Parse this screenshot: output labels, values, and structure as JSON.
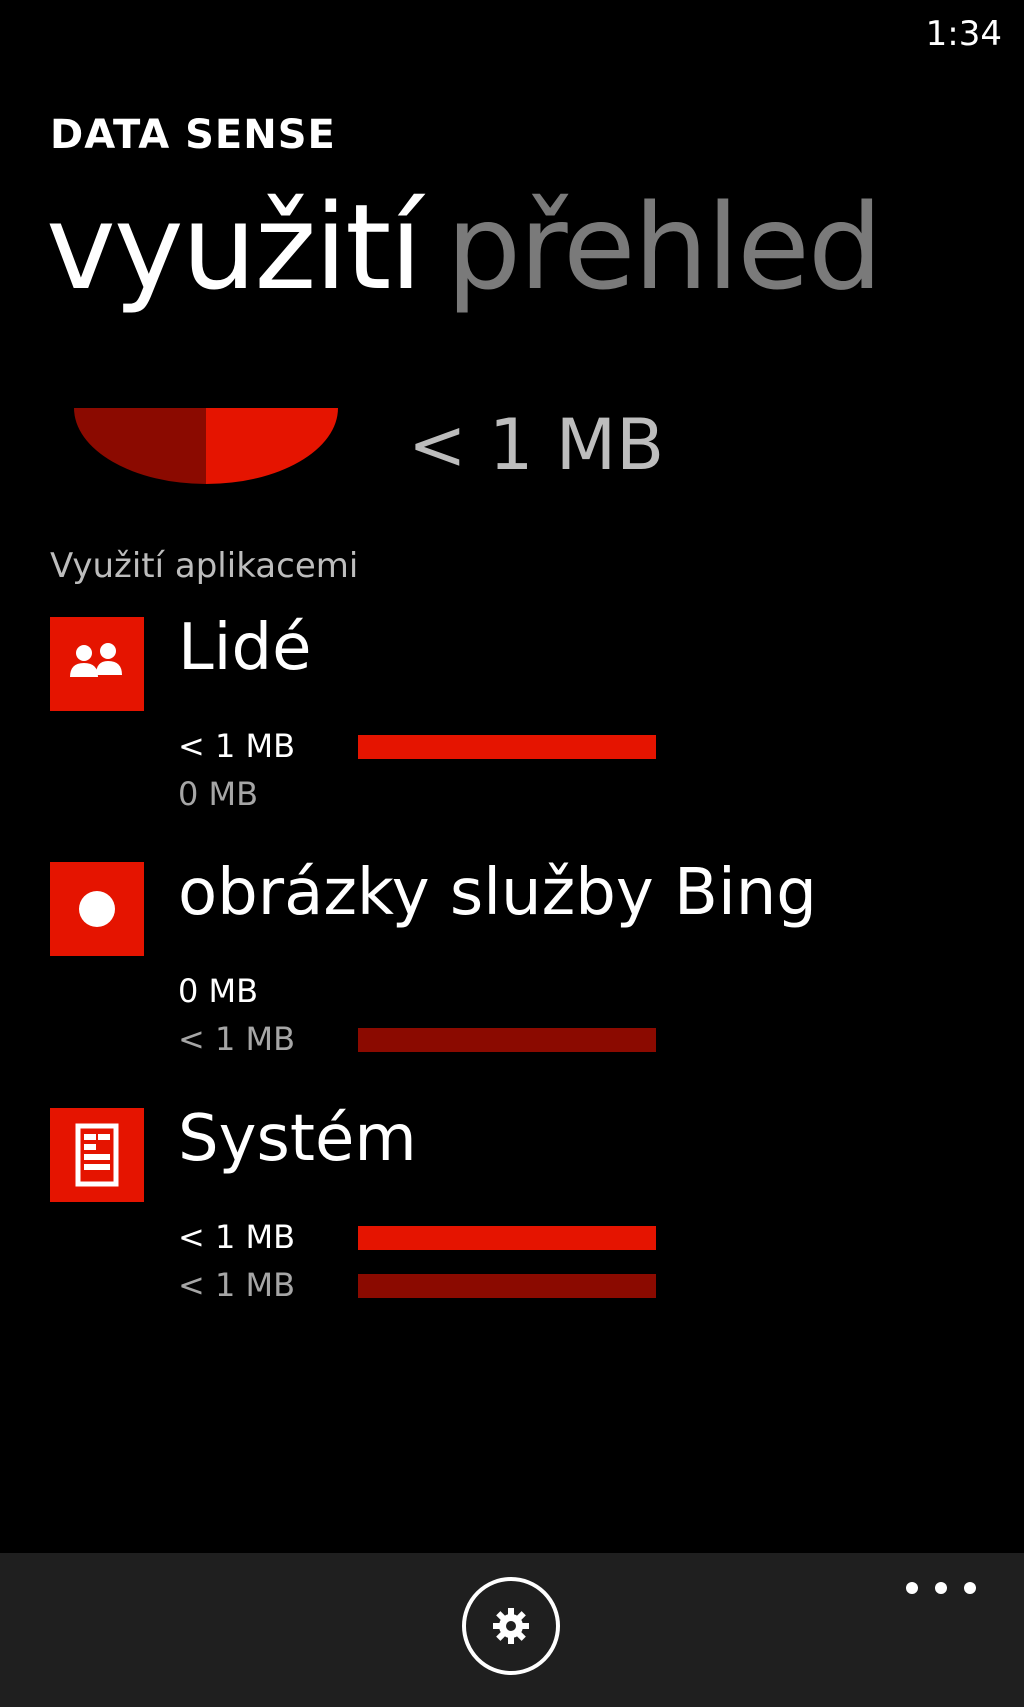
{
  "status_bar": {
    "time": "1:34"
  },
  "header": {
    "app_title": "DATA SENSE",
    "pivot_tabs": [
      {
        "label": "využití",
        "active": true
      },
      {
        "label": "přehled",
        "active": false
      }
    ]
  },
  "summary": {
    "total_usage": "< 1 MB",
    "gauge_fill_fraction": 1.0
  },
  "section_label": "Využití aplikacemi",
  "apps": [
    {
      "name": "Lidé",
      "icon": "people-icon",
      "mobile_usage": "< 1 MB",
      "wifi_usage": "0 MB",
      "mobile_bar_fraction": 1.0,
      "wifi_bar_fraction": 0
    },
    {
      "name": "obrázky služby Bing",
      "icon": "bing-images-icon",
      "mobile_usage": "0 MB",
      "wifi_usage": "< 1 MB",
      "mobile_bar_fraction": 0,
      "wifi_bar_fraction": 1.0
    },
    {
      "name": "Systém",
      "icon": "system-icon",
      "mobile_usage": "< 1 MB",
      "wifi_usage": "< 1 MB",
      "mobile_bar_fraction": 1.0,
      "wifi_bar_fraction": 1.0
    }
  ],
  "app_bar": {
    "settings_icon": "gear-icon",
    "more_icon": "ellipsis-icon"
  },
  "colors": {
    "accent": "#e51400",
    "accent_dark": "#8b0a00",
    "background": "#000000",
    "app_bar": "#1f1f1f"
  }
}
